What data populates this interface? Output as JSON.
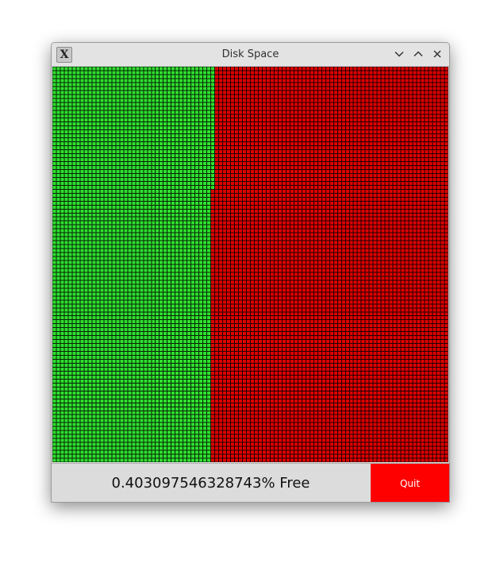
{
  "window": {
    "title": "Disk Space",
    "app_icon": "X"
  },
  "disk": {
    "free_fraction": 0.403097546328743,
    "free_color": "#2fe02f",
    "used_color": "#e00000",
    "cell_border_color": "#000000"
  },
  "footer": {
    "free_text": "0.403097546328743% Free",
    "quit_label": "Quit",
    "quit_color": "#ff0000"
  },
  "icons": {
    "app": "x-window-icon",
    "minimize": "chevron-down-icon",
    "maximize": "chevron-up-icon",
    "close": "close-icon"
  }
}
